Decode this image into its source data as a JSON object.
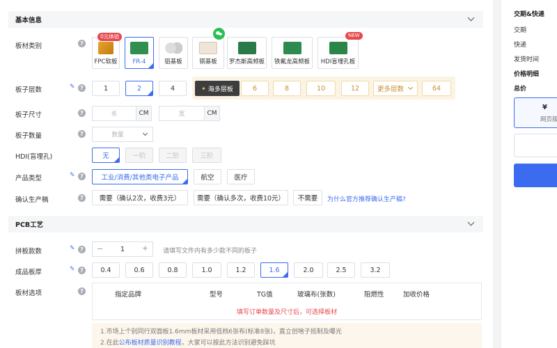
{
  "sections": {
    "basic": "基本信息",
    "pcb": "PCB工艺"
  },
  "labels": {
    "material": "板材类别",
    "layers": "板子层数",
    "size": "板子尺寸",
    "qty": "板子数量",
    "hdi": "HDI(盲埋孔)",
    "product": "产品类型",
    "confirm": "确认生产稿",
    "panel": "拼板款数",
    "thickness": "成品板厚",
    "board_opt": "板材选项"
  },
  "materials": [
    {
      "label": "FPC软板",
      "badge": "0元体验"
    },
    {
      "label": "FR-4"
    },
    {
      "label": "铝基板"
    },
    {
      "label": "铜基板"
    },
    {
      "label": "罗杰斯高频板"
    },
    {
      "label": "铁氟龙高频板"
    },
    {
      "label": "HDI盲埋孔板",
      "badge": "NEW"
    }
  ],
  "layers": {
    "basic": [
      "1",
      "2",
      "4"
    ],
    "multi_label": "海多层板",
    "multi": [
      "6",
      "8",
      "10",
      "12"
    ],
    "more": "更多层数",
    "more_value": "64"
  },
  "size": {
    "len_ph": "长",
    "wid_ph": "宽",
    "unit": "CM"
  },
  "qty": {
    "ph": "数量"
  },
  "hdi": [
    "无",
    "一阶",
    "二阶",
    "三阶"
  ],
  "product": [
    "工业/消费/其他类电子产品",
    "航空",
    "医疗"
  ],
  "confirm": {
    "options": [
      "需要（确认2次，收费3元）",
      "需要（确认多次，收费10元）",
      "不需要"
    ],
    "link": "为什么官方推荐确认生产稿?"
  },
  "panel": {
    "minus": "−",
    "value": "1",
    "plus": "+",
    "hint": "请填写文件内有多少款不同的板子"
  },
  "thickness": [
    "0.4",
    "0.6",
    "0.8",
    "1.0",
    "1.2",
    "1.6",
    "2.0",
    "2.5",
    "3.2"
  ],
  "board_table": {
    "headers": [
      "指定品牌",
      "型号",
      "TG值",
      "玻璃布(张数)",
      "阻燃性",
      "加收价格"
    ],
    "empty": "填写订单数量及尺寸后，可选择板材"
  },
  "notes": {
    "line1": "1.市场上个别同行双面板1.6mm板材采用低档6张布(标准8张)，直立创啥子抵制及曝光",
    "line2_pre": "2.在此",
    "line2_link": "公布板材质量识别教程",
    "line2_post": "，大家可以按此方法识别避免踩坑"
  },
  "side": {
    "title": "交期&快递",
    "delivery": "交期",
    "express": "快递",
    "ship_time": "发货时间",
    "price_detail": "价格明细",
    "total": "总价",
    "price": "¥",
    "web": "网页版"
  },
  "colors": {
    "accent": "#3b6cf0",
    "gold": "#c98d2e",
    "red": "#e5484d"
  }
}
